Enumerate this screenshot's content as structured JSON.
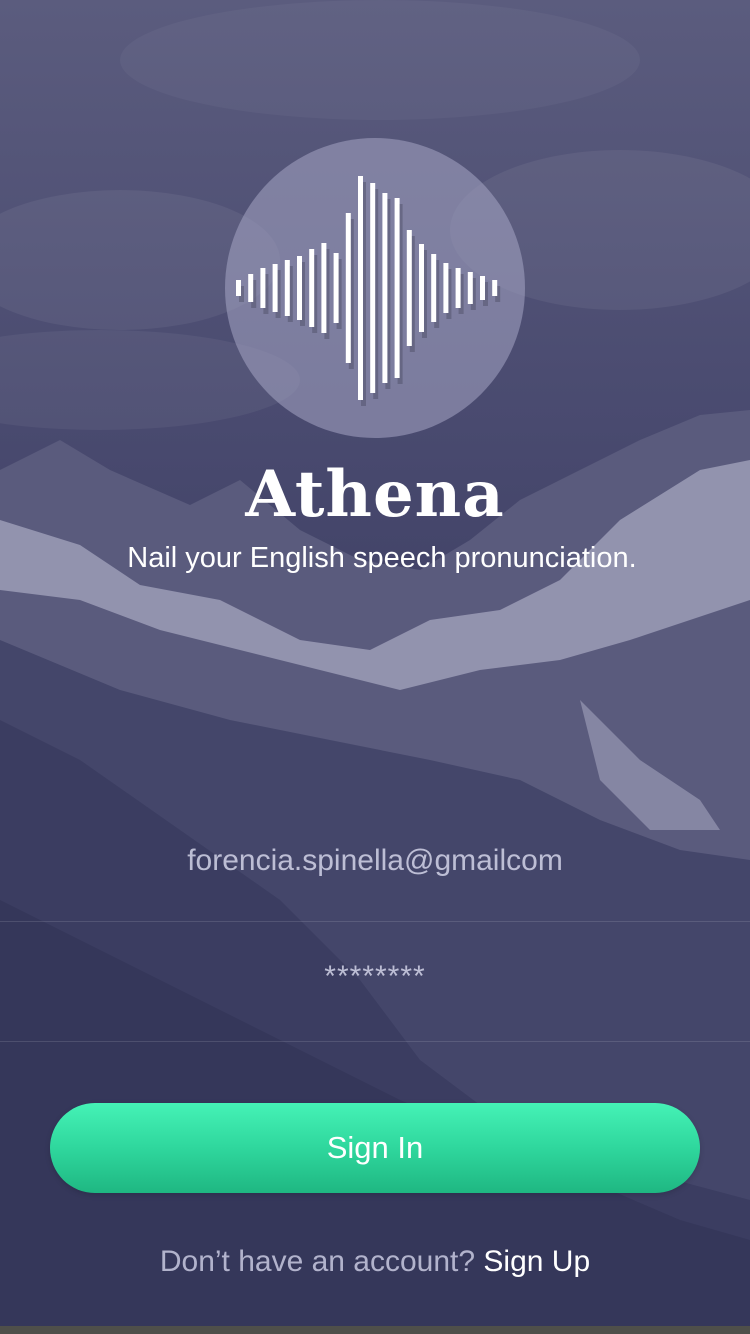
{
  "app": {
    "title": "Athena",
    "tagline": "Nail your English speech pronunciation."
  },
  "form": {
    "email_value": "forencia.spinella@gmailcom",
    "password_value": "********",
    "signin_label": "Sign In"
  },
  "signup": {
    "prompt": "Don’t have an account?",
    "link_label": "Sign Up"
  },
  "colors": {
    "button_top": "#45f2b6",
    "button_bottom": "#1fb782",
    "background": "#3f4063",
    "text": "#ffffff"
  },
  "icons": {
    "logo": "waveform-icon"
  }
}
